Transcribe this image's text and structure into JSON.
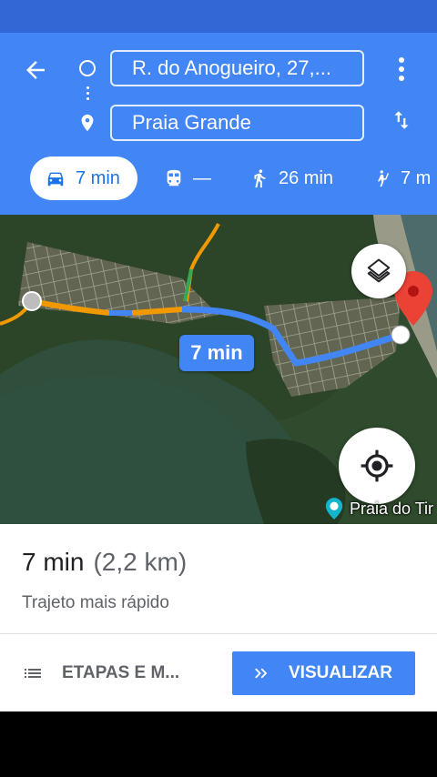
{
  "route": {
    "origin": "R. do Anogueiro, 27,...",
    "destination": "Praia Grande"
  },
  "modes": [
    {
      "name": "car",
      "label": "7 min",
      "selected": true
    },
    {
      "name": "transit",
      "label": "—",
      "selected": false
    },
    {
      "name": "walk",
      "label": "26 min",
      "selected": false
    },
    {
      "name": "ride",
      "label": "7 m",
      "selected": false
    }
  ],
  "map": {
    "route_time": "7 min",
    "place_label": "Praia do Tir"
  },
  "summary": {
    "time": "7 min",
    "distance": "(2,2 km)",
    "subtitle": "Trajeto mais rápido"
  },
  "actions": {
    "steps_label": "ETAPAS E M...",
    "preview_label": "VISUALIZAR"
  },
  "colors": {
    "header": "#4285f4",
    "statusbar": "#3367d6",
    "route": "#4285f4",
    "traffic_orange": "#f29900",
    "destination_pin": "#ea4335"
  },
  "icons": [
    "back-arrow-icon",
    "origin-circle-icon",
    "destination-pin-icon",
    "more-vert-icon",
    "swap-icon",
    "car-icon",
    "transit-icon",
    "walk-icon",
    "ride-icon",
    "layers-icon",
    "my-location-icon",
    "list-icon",
    "chevron-double-right-icon"
  ]
}
